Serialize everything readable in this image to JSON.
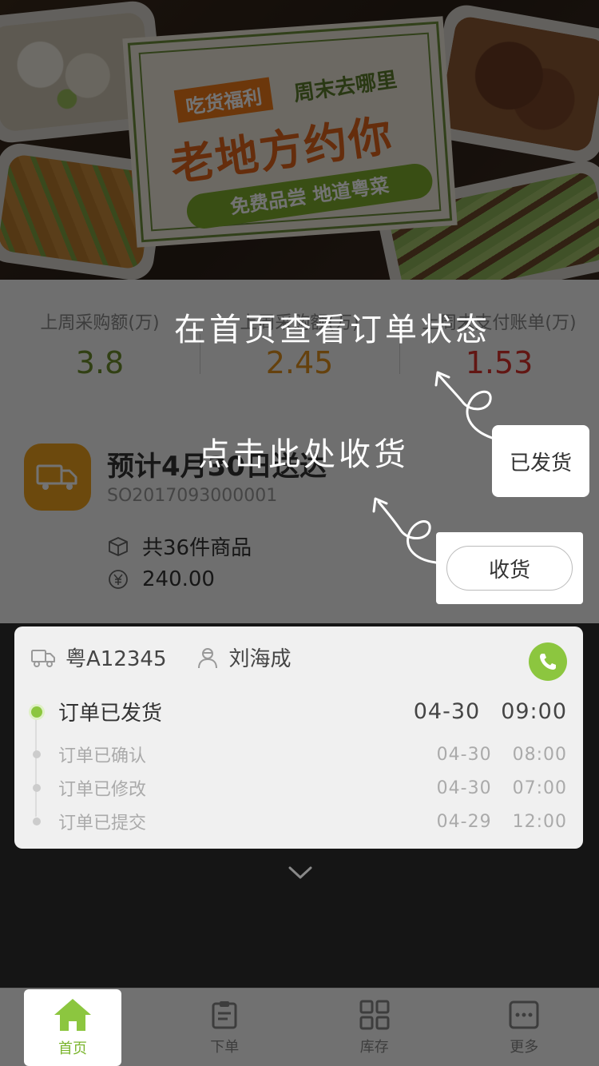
{
  "banner": {
    "tag": "吃货福利",
    "subtitle": "周末去哪里",
    "headline": "老地方约你",
    "pill": "免费品尝 地道粤菜"
  },
  "stats": [
    {
      "label": "上周采购额(万)",
      "value": "3.8",
      "color": "#6d8f2a"
    },
    {
      "label": "上周采购额(万)",
      "value": "2.45",
      "color": "#e0911e"
    },
    {
      "label": "上周未支付账单(万)",
      "value": "1.53",
      "color": "#d9312b"
    }
  ],
  "order": {
    "title": "预计4月30日送达",
    "number": "SO2017093000001",
    "items": "共36件商品",
    "amount": "240.00",
    "status_badge": "已发货",
    "receive_button": "收货"
  },
  "tracking": {
    "plate": "粤A12345",
    "driver": "刘海成",
    "events": [
      {
        "label": "订单已发货",
        "date": "04-30",
        "time": "09:00",
        "active": true
      },
      {
        "label": "订单已确认",
        "date": "04-30",
        "time": "08:00",
        "active": false
      },
      {
        "label": "订单已修改",
        "date": "04-30",
        "time": "07:00",
        "active": false
      },
      {
        "label": "订单已提交",
        "date": "04-29",
        "time": "12:00",
        "active": false
      }
    ]
  },
  "guide": {
    "status_tip": "在首页查看订单状态",
    "receive_tip": "点击此处收货"
  },
  "tabs": [
    {
      "label": "首页",
      "icon": "home-icon",
      "active": true
    },
    {
      "label": "下单",
      "icon": "clipboard-icon",
      "active": false
    },
    {
      "label": "库存",
      "icon": "grid-icon",
      "active": false
    },
    {
      "label": "更多",
      "icon": "more-icon",
      "active": false
    }
  ],
  "colors": {
    "accent_green": "#8cc63f",
    "orange": "#f0a21d"
  }
}
